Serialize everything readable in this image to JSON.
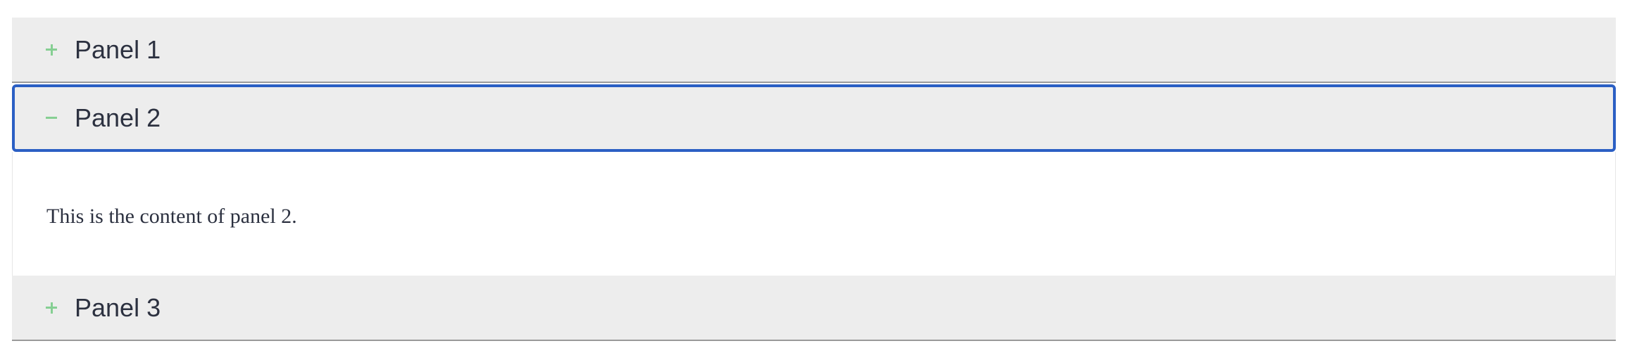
{
  "accordion": {
    "panels": [
      {
        "title": "Panel 1",
        "expanded": false,
        "icon": "plus-icon"
      },
      {
        "title": "Panel 2",
        "expanded": true,
        "icon": "minus-icon",
        "content": "This is the content of panel 2."
      },
      {
        "title": "Panel 3",
        "expanded": false,
        "icon": "plus-icon"
      }
    ]
  },
  "colors": {
    "header_background": "#ededed",
    "focus_outline": "#2b5fc4",
    "icon": "#86cf93",
    "text": "#2c3140"
  }
}
